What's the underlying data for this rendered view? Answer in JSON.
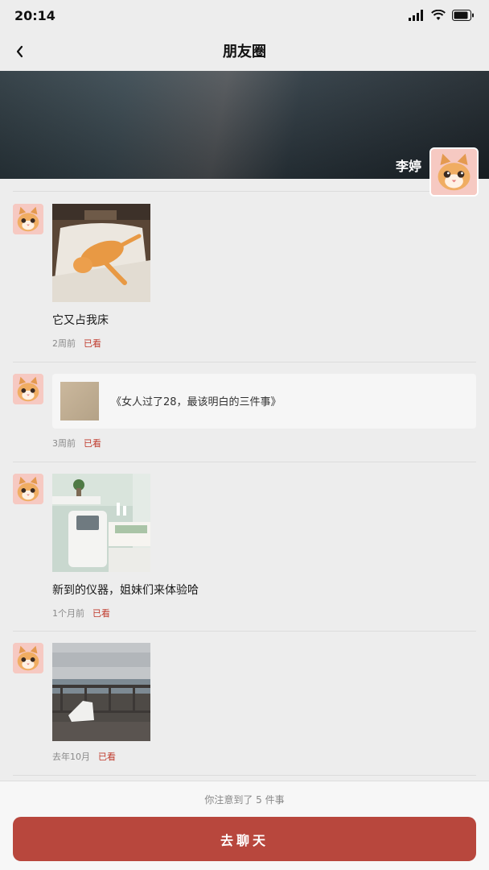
{
  "status_bar": {
    "time": "20:14"
  },
  "nav": {
    "title": "朋友圈"
  },
  "profile": {
    "name": "李婷"
  },
  "posts": [
    {
      "text": "它又占我床",
      "time": "2周前",
      "seen": "已看",
      "photo": "orange-cat-on-bed"
    },
    {
      "link_title": "《女人过了28，最该明白的三件事》",
      "time": "3周前",
      "seen": "已看"
    },
    {
      "text": "新到的仪器，姐妹们来体验哈",
      "time": "1个月前",
      "seen": "已看",
      "photo": "beauty-device-room"
    },
    {
      "time": "去年10月",
      "seen": "已看",
      "photo": "seaside-deck-chair"
    }
  ],
  "footer": {
    "notice": "你注意到了 5 件事",
    "chat_label": "去聊天"
  },
  "colors": {
    "accent": "#b8473d",
    "seen": "#c0392b",
    "background": "#ededed"
  }
}
